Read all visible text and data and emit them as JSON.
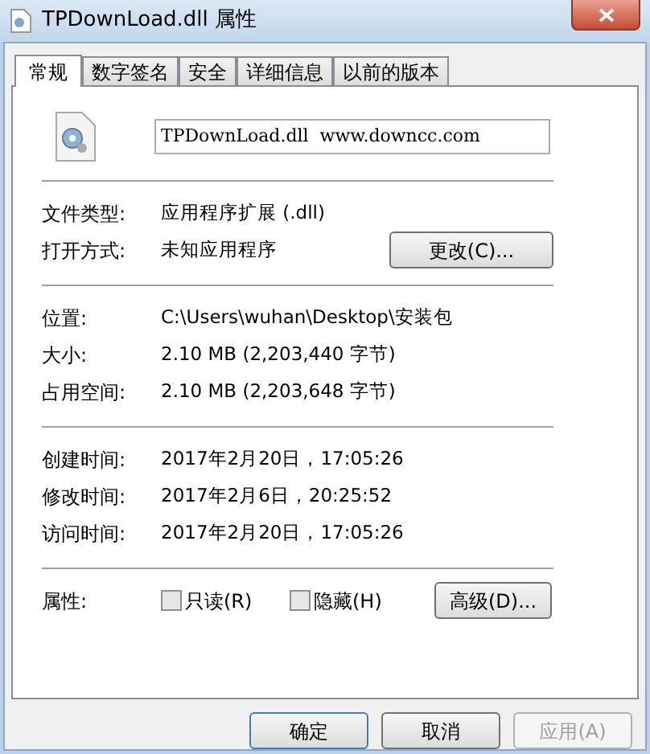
{
  "window": {
    "title": "TPDownLoad.dll 属性"
  },
  "tabs": [
    {
      "label": "常规",
      "selected": true
    },
    {
      "label": "数字签名",
      "selected": false
    },
    {
      "label": "安全",
      "selected": false
    },
    {
      "label": "详细信息",
      "selected": false
    },
    {
      "label": "以前的版本",
      "selected": false
    }
  ],
  "file_name": "TPDownLoad.dll  www.downcc.com",
  "sections": [
    {
      "rows": [
        {
          "label": "文件类型:",
          "value": "应用程序扩展 (.dll)"
        },
        {
          "label": "打开方式:",
          "value": "未知应用程序",
          "button": "更改(C)..."
        }
      ]
    },
    {
      "rows": [
        {
          "label": "位置:",
          "value": "C:\\Users\\wuhan\\Desktop\\安装包"
        },
        {
          "label": "大小:",
          "value": "2.10 MB (2,203,440 字节)"
        },
        {
          "label": "占用空间:",
          "value": "2.10 MB (2,203,648 字节)"
        }
      ]
    },
    {
      "rows": [
        {
          "label": "创建时间:",
          "value": "2017年2月20日，17:05:26"
        },
        {
          "label": "修改时间:",
          "value": "2017年2月6日，20:25:52"
        },
        {
          "label": "访问时间:",
          "value": "2017年2月20日，17:05:26"
        }
      ]
    }
  ],
  "attributes": {
    "label": "属性:",
    "checkboxes": [
      {
        "label": "只读(R)",
        "checked": false
      },
      {
        "label": "隐藏(H)",
        "checked": false
      }
    ],
    "button": "高级(D)..."
  },
  "buttons": [
    {
      "label": "确定",
      "disabled": false,
      "default": true
    },
    {
      "label": "取消",
      "disabled": false,
      "default": false
    },
    {
      "label": "应用(A)",
      "disabled": true,
      "default": false
    }
  ]
}
